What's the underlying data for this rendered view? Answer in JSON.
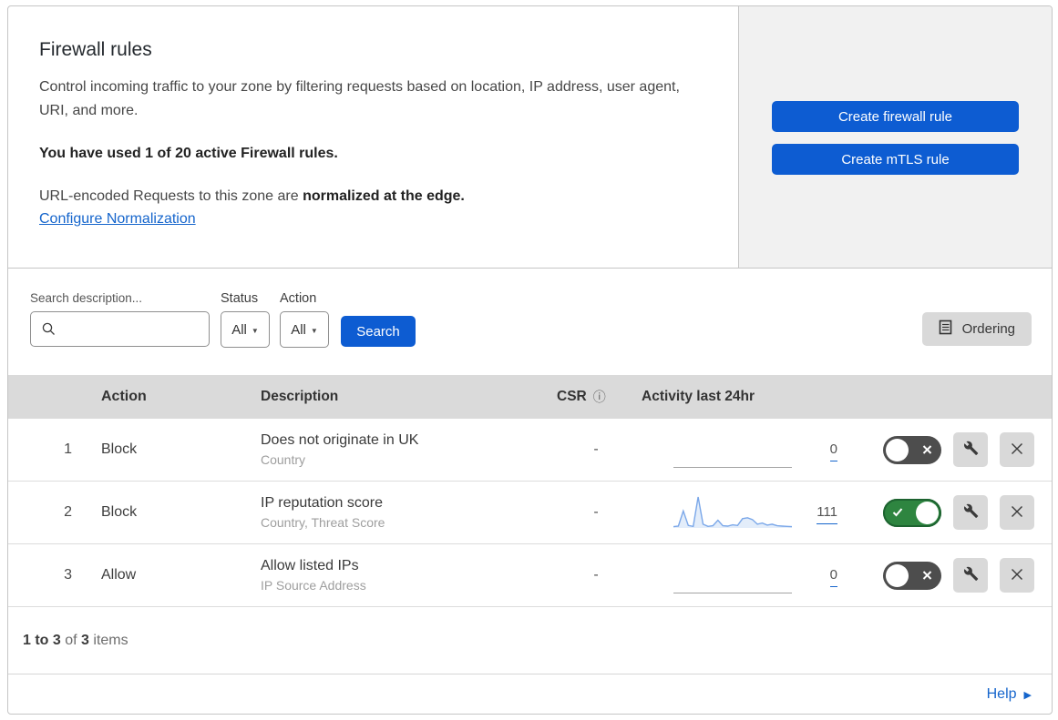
{
  "header": {
    "title": "Firewall rules",
    "description": "Control incoming traffic to your zone by filtering requests based on location, IP address, user agent, URI, and more.",
    "usage_note": "You have used 1 of 20 active Firewall rules.",
    "normalization_text": "URL-encoded Requests to this zone are ",
    "normalization_bold": "normalized at the edge.",
    "normalization_link": "Configure Normalization",
    "create_firewall_button": "Create firewall rule",
    "create_mtls_button": "Create mTLS rule"
  },
  "filters": {
    "search_label": "Search description...",
    "search_value": "",
    "status_label": "Status",
    "status_value": "All",
    "action_label": "Action",
    "action_value": "All",
    "search_button": "Search",
    "ordering_button": "Ordering"
  },
  "table": {
    "header": {
      "action": "Action",
      "description": "Description",
      "csr": "CSR",
      "activity": "Activity last 24hr"
    },
    "rows": [
      {
        "priority": "1",
        "action": "Block",
        "description": "Does not originate in UK",
        "match_fields": "Country",
        "csr": "-",
        "activity_count": "0",
        "enabled": false,
        "sparkline": null
      },
      {
        "priority": "2",
        "action": "Block",
        "description": "IP reputation score",
        "match_fields": "Country, Threat Score",
        "csr": "-",
        "activity_count": "111",
        "enabled": true,
        "sparkline": [
          4,
          6,
          55,
          8,
          5,
          100,
          12,
          5,
          7,
          25,
          7,
          6,
          10,
          8,
          30,
          33,
          27,
          12,
          16,
          9,
          12,
          7,
          6,
          5,
          4
        ]
      },
      {
        "priority": "3",
        "action": "Allow",
        "description": "Allow listed IPs",
        "match_fields": "IP Source Address",
        "csr": "-",
        "activity_count": "0",
        "enabled": false,
        "sparkline": null
      }
    ]
  },
  "footer": {
    "range": "1 to 3",
    "of": " of ",
    "total": "3",
    "items": " items"
  },
  "help": {
    "label": "Help"
  },
  "colors": {
    "button_blue": "#0d5cd2",
    "link_blue": "#1565cc",
    "toggle_on_green": "#2e8540",
    "toggle_off_gray": "#4d4d4d",
    "sparkline_blue": "#7aa7e9",
    "sparkline_fill": "#e3edfa"
  }
}
